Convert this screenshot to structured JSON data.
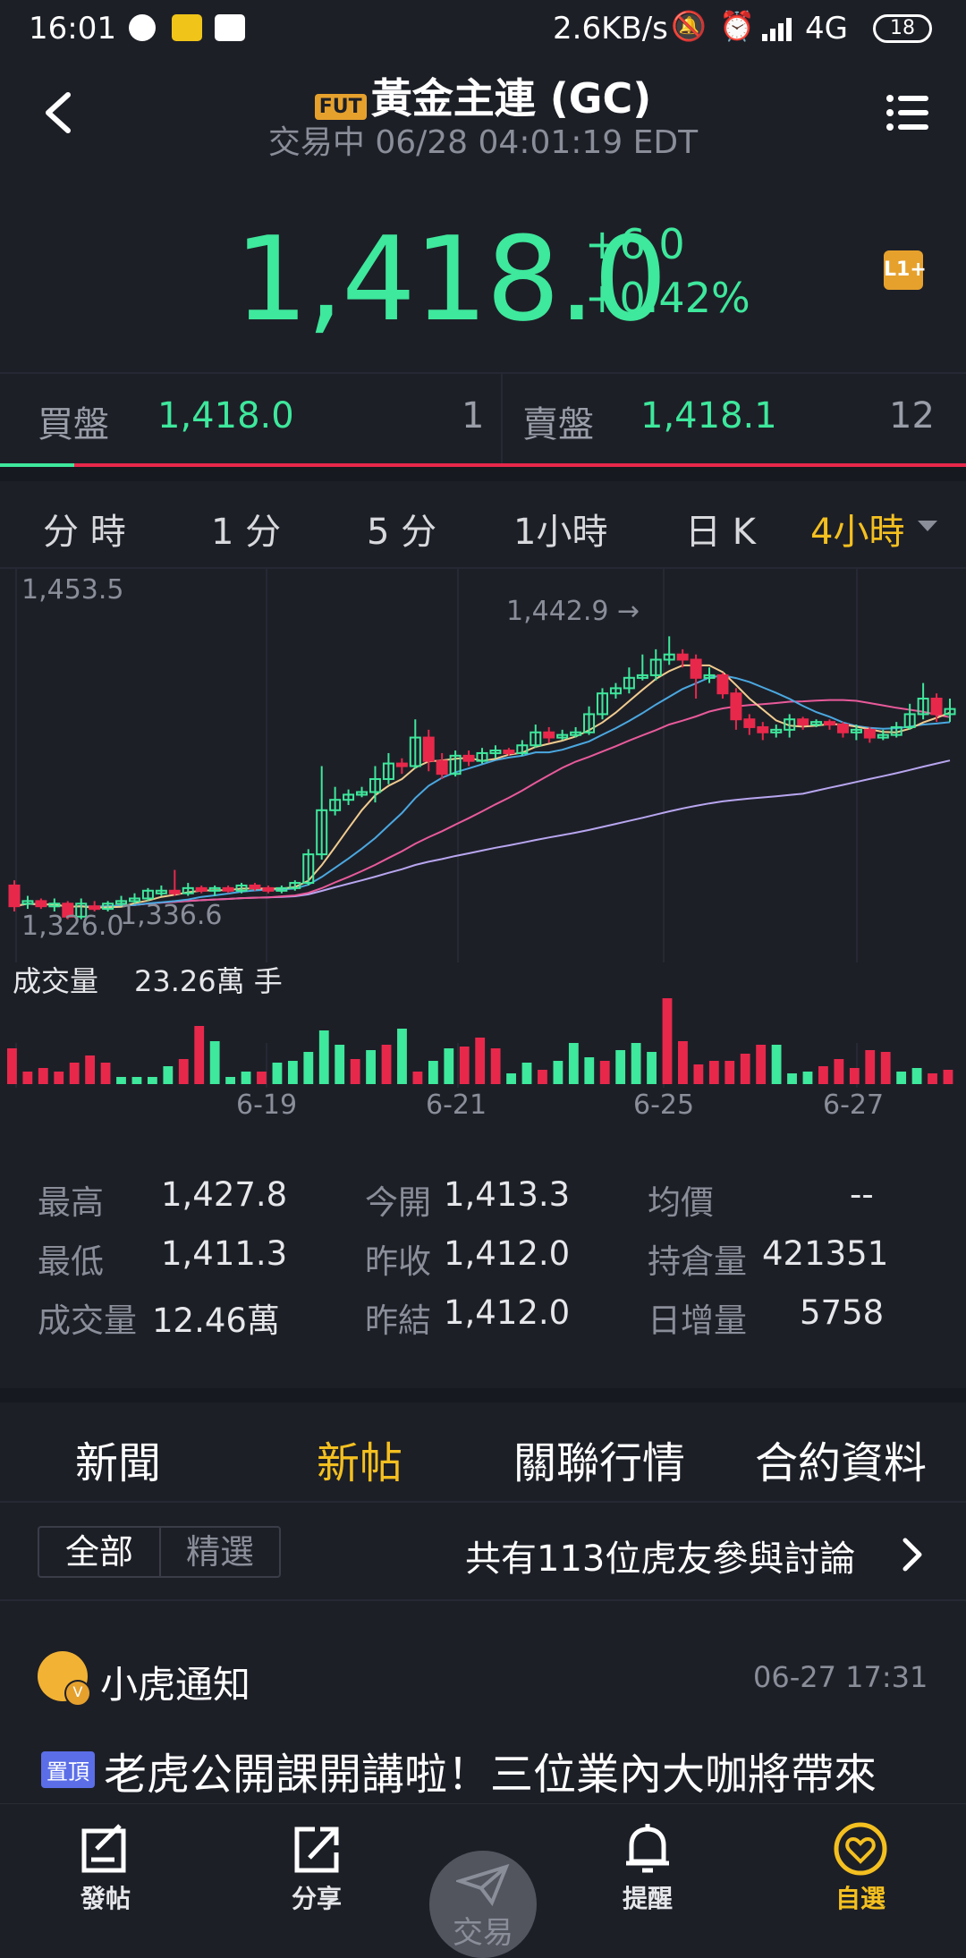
{
  "status_bar": {
    "time": "16:01",
    "net_speed": "2.6KB/s",
    "network": "4G",
    "battery": "18"
  },
  "header": {
    "badge": "FUT",
    "title": "黃金主連 (GC)",
    "subtitle": "交易中 06/28 04:01:19 EDT"
  },
  "quote": {
    "price": "1,418.0",
    "change": "+6.0",
    "change_pct": "+0.42%",
    "l2_badge": "L1+"
  },
  "bid_ask": {
    "bid_label": "買盤",
    "bid_price": "1,418.0",
    "bid_size": "1",
    "ask_label": "賣盤",
    "ask_price": "1,418.1",
    "ask_size": "12",
    "bid_share": 0.077
  },
  "period_tabs": [
    "分 時",
    "1 分",
    "5 分",
    "1小時",
    "日 K",
    "4小時"
  ],
  "active_tab": "4小時",
  "chart_data": {
    "type": "candlestick",
    "high_label": "1,453.5",
    "low_label": "1,326.0",
    "max_marker": "1,442.9 →",
    "min_marker": "1,336.6",
    "ylim": [
      1326.0,
      1453.5
    ],
    "x_ticks": [
      "6-19",
      "6-21",
      "6-25",
      "6-27"
    ],
    "candles": [
      [
        1346,
        1338,
        1348,
        1336
      ],
      [
        1339,
        1340,
        1342,
        1337
      ],
      [
        1340,
        1338,
        1341,
        1337
      ],
      [
        1338,
        1339,
        1341,
        1336
      ],
      [
        1339,
        1334,
        1340,
        1333
      ],
      [
        1334,
        1339,
        1341,
        1333
      ],
      [
        1338,
        1337,
        1340,
        1336
      ],
      [
        1337,
        1339,
        1340,
        1336
      ],
      [
        1339,
        1340,
        1342,
        1338
      ],
      [
        1340,
        1341,
        1343,
        1339
      ],
      [
        1341,
        1344,
        1345,
        1340
      ],
      [
        1343,
        1344,
        1346,
        1342
      ],
      [
        1344,
        1343,
        1352,
        1342
      ],
      [
        1343,
        1345,
        1347,
        1342
      ],
      [
        1345,
        1344,
        1346,
        1343
      ],
      [
        1344,
        1345,
        1346,
        1342
      ],
      [
        1345,
        1344,
        1346,
        1343
      ],
      [
        1344,
        1346,
        1347,
        1343
      ],
      [
        1346,
        1345,
        1347,
        1344
      ],
      [
        1345,
        1344,
        1346,
        1343
      ],
      [
        1344,
        1345,
        1346,
        1343
      ],
      [
        1345,
        1347,
        1348,
        1344
      ],
      [
        1347,
        1358,
        1360,
        1346
      ],
      [
        1358,
        1375,
        1392,
        1356
      ],
      [
        1375,
        1379,
        1384,
        1373
      ],
      [
        1379,
        1381,
        1383,
        1377
      ],
      [
        1381,
        1382,
        1384,
        1380
      ],
      [
        1382,
        1387,
        1392,
        1378
      ],
      [
        1387,
        1393,
        1397,
        1385
      ],
      [
        1393,
        1392,
        1395,
        1389
      ],
      [
        1392,
        1403,
        1410,
        1391
      ],
      [
        1403,
        1394,
        1406,
        1390
      ],
      [
        1394,
        1389,
        1397,
        1387
      ],
      [
        1389,
        1396,
        1398,
        1388
      ],
      [
        1396,
        1394,
        1398,
        1392
      ],
      [
        1394,
        1397,
        1399,
        1393
      ],
      [
        1397,
        1398,
        1400,
        1395
      ],
      [
        1398,
        1397,
        1399,
        1396
      ],
      [
        1397,
        1400,
        1402,
        1396
      ],
      [
        1400,
        1405,
        1408,
        1399
      ],
      [
        1405,
        1403,
        1407,
        1401
      ],
      [
        1403,
        1404,
        1406,
        1402
      ],
      [
        1404,
        1405,
        1407,
        1403
      ],
      [
        1405,
        1412,
        1415,
        1404
      ],
      [
        1412,
        1420,
        1422,
        1410
      ],
      [
        1420,
        1422,
        1424,
        1418
      ],
      [
        1422,
        1426,
        1430,
        1420
      ],
      [
        1426,
        1427,
        1435,
        1425
      ],
      [
        1427,
        1433,
        1437,
        1425
      ],
      [
        1433,
        1435,
        1442,
        1431
      ],
      [
        1435,
        1433,
        1437,
        1430
      ],
      [
        1433,
        1426,
        1435,
        1418
      ],
      [
        1426,
        1427,
        1430,
        1424
      ],
      [
        1427,
        1420,
        1428,
        1418
      ],
      [
        1420,
        1410,
        1422,
        1406
      ],
      [
        1410,
        1407,
        1412,
        1404
      ],
      [
        1407,
        1405,
        1409,
        1402
      ],
      [
        1405,
        1406,
        1408,
        1403
      ],
      [
        1406,
        1410,
        1412,
        1403
      ],
      [
        1410,
        1408,
        1411,
        1406
      ],
      [
        1408,
        1409,
        1410,
        1407
      ],
      [
        1409,
        1408,
        1410,
        1406
      ],
      [
        1408,
        1405,
        1409,
        1403
      ],
      [
        1405,
        1406,
        1408,
        1402
      ],
      [
        1406,
        1403,
        1407,
        1401
      ],
      [
        1403,
        1404,
        1406,
        1402
      ],
      [
        1404,
        1407,
        1409,
        1403
      ],
      [
        1407,
        1412,
        1416,
        1406
      ],
      [
        1412,
        1418,
        1424,
        1410
      ],
      [
        1418,
        1412,
        1420,
        1409
      ],
      [
        1412,
        1414,
        1418,
        1409
      ]
    ],
    "volume_label": "成交量",
    "volume_value": "23.26萬 手",
    "volume": [
      [
        40,
        0
      ],
      [
        14,
        0
      ],
      [
        18,
        0
      ],
      [
        14,
        0
      ],
      [
        24,
        0
      ],
      [
        32,
        0
      ],
      [
        24,
        0
      ],
      [
        8,
        1
      ],
      [
        8,
        1
      ],
      [
        8,
        1
      ],
      [
        20,
        1
      ],
      [
        28,
        0
      ],
      [
        65,
        0
      ],
      [
        48,
        1
      ],
      [
        8,
        1
      ],
      [
        14,
        1
      ],
      [
        14,
        0
      ],
      [
        24,
        1
      ],
      [
        26,
        1
      ],
      [
        36,
        1
      ],
      [
        60,
        1
      ],
      [
        44,
        1
      ],
      [
        28,
        0
      ],
      [
        38,
        1
      ],
      [
        44,
        0
      ],
      [
        62,
        1
      ],
      [
        14,
        0
      ],
      [
        26,
        1
      ],
      [
        40,
        1
      ],
      [
        42,
        0
      ],
      [
        52,
        0
      ],
      [
        40,
        0
      ],
      [
        12,
        1
      ],
      [
        24,
        1
      ],
      [
        16,
        0
      ],
      [
        26,
        1
      ],
      [
        46,
        1
      ],
      [
        30,
        1
      ],
      [
        26,
        0
      ],
      [
        38,
        1
      ],
      [
        46,
        1
      ],
      [
        36,
        1
      ],
      [
        96,
        0
      ],
      [
        48,
        0
      ],
      [
        22,
        0
      ],
      [
        26,
        0
      ],
      [
        26,
        0
      ],
      [
        34,
        0
      ],
      [
        44,
        0
      ],
      [
        44,
        1
      ],
      [
        12,
        1
      ],
      [
        14,
        1
      ],
      [
        20,
        0
      ],
      [
        28,
        0
      ],
      [
        18,
        0
      ],
      [
        38,
        0
      ],
      [
        36,
        0
      ],
      [
        14,
        1
      ],
      [
        18,
        1
      ],
      [
        12,
        0
      ],
      [
        16,
        0
      ]
    ],
    "colors": {
      "up": "#3ee89c",
      "down": "#e8284b",
      "ma5": "#f1cc8f",
      "ma10": "#4aa8e0",
      "ma20": "#e85a9a",
      "ma60": "#b8a6f0"
    }
  },
  "stats": [
    {
      "label": "最高",
      "value": "1,427.8"
    },
    {
      "label": "今開",
      "value": "1,413.3"
    },
    {
      "label": "均價",
      "value": "--"
    },
    {
      "label": "最低",
      "value": "1,411.3"
    },
    {
      "label": "昨收",
      "value": "1,412.0"
    },
    {
      "label": "持倉量",
      "value": "421351"
    },
    {
      "label": "成交量",
      "value": "12.46萬"
    },
    {
      "label": "昨結",
      "value": "1,412.0"
    },
    {
      "label": "日增量",
      "value": "5758"
    }
  ],
  "section_tabs": [
    "新聞",
    "新帖",
    "關聯行情",
    "合約資料"
  ],
  "active_section": "新帖",
  "filter": {
    "all": "全部",
    "featured": "精選",
    "participants": "共有113位虎友參與討論"
  },
  "post": {
    "author": "小虎通知",
    "time": "06-27 17:31",
    "pin_badge": "置頂",
    "text": "老虎公開課開講啦！三位業內大咖將帶來"
  },
  "bottom_nav": {
    "post": "發帖",
    "share": "分享",
    "trade": "交易",
    "alert": "提醒",
    "watch": "自選"
  }
}
